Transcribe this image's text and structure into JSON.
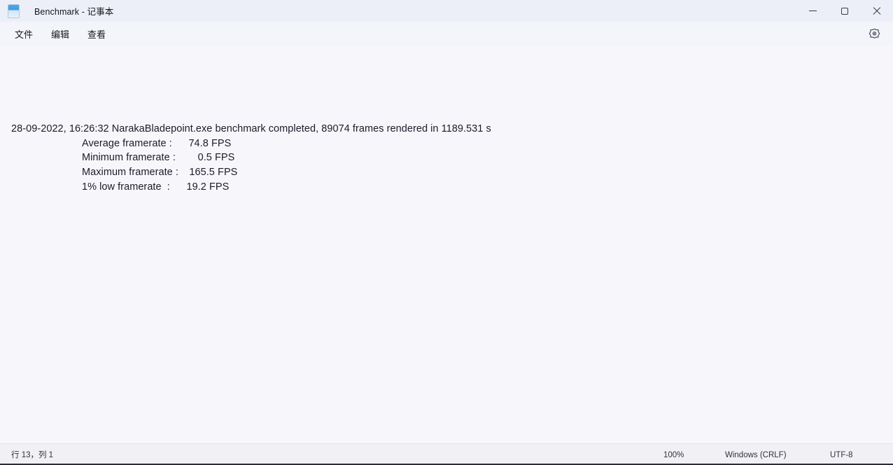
{
  "window": {
    "title": "Benchmark - 记事本",
    "app_icon": "notepad-document-icon",
    "controls": {
      "minimize_label": "最小化",
      "maximize_label": "最大化",
      "close_label": "关闭"
    }
  },
  "menubar": {
    "items": [
      {
        "label": "文件",
        "name": "menu-file"
      },
      {
        "label": "编辑",
        "name": "menu-edit"
      },
      {
        "label": "查看",
        "name": "menu-view"
      }
    ],
    "settings_icon": "gear-icon"
  },
  "document": {
    "header_line": "28-09-2022, 16:26:32 NarakaBladepoint.exe benchmark completed, 89074 frames rendered in 1189.531 s",
    "stats": [
      {
        "label": "Average framerate ",
        "separator": ":",
        "value": "74.8",
        "unit": "FPS"
      },
      {
        "label": "Minimum framerate ",
        "separator": ":",
        "value": "0.5",
        "unit": "FPS"
      },
      {
        "label": "Maximum framerate ",
        "separator": ":",
        "value": "165.5",
        "unit": "FPS"
      },
      {
        "label": "1% low framerate  ",
        "separator": ":",
        "value": "19.2",
        "unit": "FPS"
      }
    ]
  },
  "statusbar": {
    "cursor_position": "行 13，列 1",
    "zoom": "100%",
    "line_ending": "Windows (CRLF)",
    "encoding": "UTF-8"
  },
  "colors": {
    "titlebar_bg": "#eceff8",
    "menubar_bg": "#f4f5fa",
    "editor_bg": "#f7f7fb",
    "statusbar_bg": "#f1f1f5",
    "text": "#1b1b2a",
    "icon_accent": "#3f9ee0"
  }
}
